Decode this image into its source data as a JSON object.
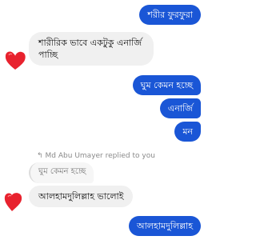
{
  "messages": {
    "out_1": "শরীর ফুরফুরা",
    "in_1": "শারীরিক ভাবে একটুকু এনার্জি পাচ্ছি",
    "out_2": "ঘুম কেমন হচ্ছে",
    "out_3": "এনার্জি",
    "out_4": "মন",
    "reply_header": "Md Abu Umayer replied to you",
    "quoted_text": "ঘুম কেমন হচ্ছে",
    "in_2": "আলহামদুলিল্লাহ ভালোই",
    "out_5": "আলহামদুলিল্লাহ"
  },
  "reactions": {
    "icon": "heart-icon",
    "color": "#e8222e"
  },
  "colors": {
    "outgoing_bubble": "#1a56d6",
    "incoming_bubble": "#f0f0f0"
  }
}
